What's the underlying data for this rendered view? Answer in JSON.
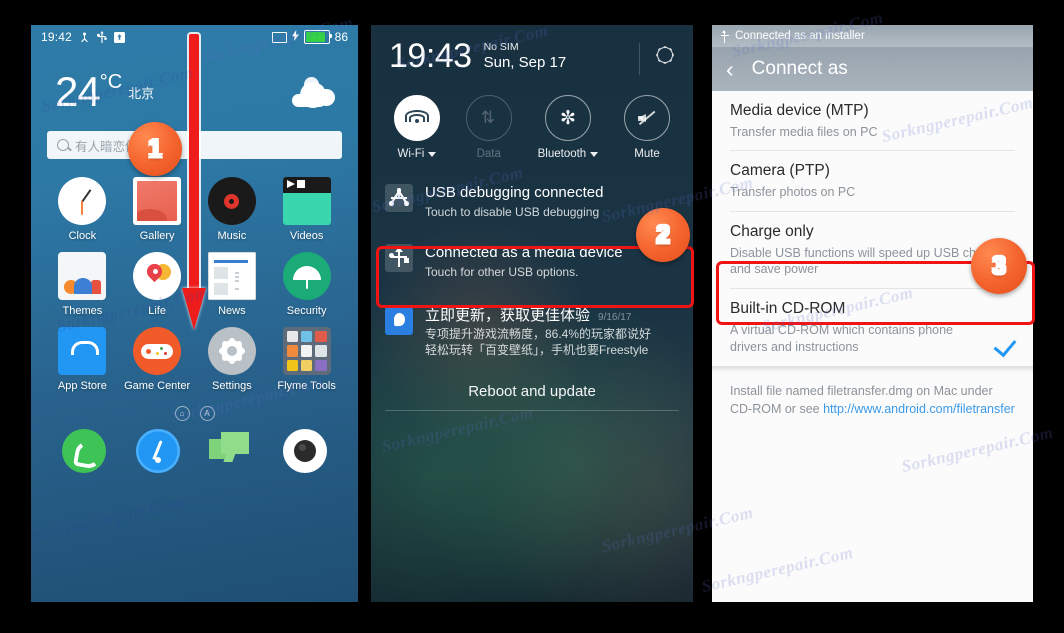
{
  "meta": {
    "watermark_text": "Sorkngperepair.Com"
  },
  "panel1": {
    "name": "Flyme home screen",
    "status_bar": {
      "time": "19:42",
      "battery_percent": "86",
      "icons": [
        "adb-icon",
        "usb-icon",
        "download-icon",
        "sim-icon",
        "charging-icon",
        "battery-icon"
      ]
    },
    "weather": {
      "temperature": "24",
      "degree_symbol": "°C",
      "city": "北京",
      "icon": "partly-cloudy-icon"
    },
    "search": {
      "placeholder": "有人暗恋你",
      "icon": "search-icon"
    },
    "apps": [
      {
        "label": "Clock",
        "icon": "clock-icon"
      },
      {
        "label": "Gallery",
        "icon": "gallery-icon"
      },
      {
        "label": "Music",
        "icon": "music-icon"
      },
      {
        "label": "Videos",
        "icon": "videos-icon"
      },
      {
        "label": "Themes",
        "icon": "themes-icon"
      },
      {
        "label": "Life",
        "icon": "life-icon"
      },
      {
        "label": "News",
        "icon": "news-icon"
      },
      {
        "label": "Security",
        "icon": "security-icon"
      },
      {
        "label": "App Store",
        "icon": "app-store-icon"
      },
      {
        "label": "Game Center",
        "icon": "game-center-icon"
      },
      {
        "label": "Settings",
        "icon": "settings-icon"
      },
      {
        "label": "Flyme Tools",
        "icon": "flyme-tools-icon"
      }
    ],
    "page_indicators": [
      "home-page-dot",
      "apps-page-dot"
    ],
    "dock": [
      {
        "label": "Phone",
        "icon": "phone-icon"
      },
      {
        "label": "Browser",
        "icon": "browser-icon"
      },
      {
        "label": "Messaging",
        "icon": "messaging-icon"
      },
      {
        "label": "Camera",
        "icon": "camera-icon"
      }
    ],
    "gesture": "swipe-down-arrow"
  },
  "panel2": {
    "name": "Notification shade",
    "time": "19:43",
    "sim_status": "No SIM",
    "date": "Sun, Sep 17",
    "settings_icon": "gear-icon",
    "toggles": [
      {
        "label": "Wi-Fi",
        "icon": "wifi-icon",
        "state": "on",
        "has_caret": true
      },
      {
        "label": "Data",
        "icon": "data-icon",
        "state": "disabled",
        "has_caret": false
      },
      {
        "label": "Bluetooth",
        "icon": "bluetooth-icon",
        "state": "off",
        "has_caret": true
      },
      {
        "label": "Mute",
        "icon": "mute-icon",
        "state": "off",
        "has_caret": false
      }
    ],
    "notifications": [
      {
        "title": "USB debugging connected",
        "subtitle": "Touch to disable USB debugging",
        "icon": "adb-icon",
        "date": "",
        "highlighted": false
      },
      {
        "title": "Connected as a media device",
        "subtitle": "Touch for other USB options.",
        "icon": "usb-icon",
        "date": "",
        "highlighted": true
      },
      {
        "title": "立即更新，获取更佳体验",
        "subtitle": "专项提升游戏流畅度，86.4%的玩家都说好\n轻松玩转「百变壁纸」，手机也要Freestyle",
        "icon": "update-icon",
        "date": "9/16/17",
        "highlighted": false
      }
    ],
    "action_label": "Reboot and update"
  },
  "panel3": {
    "name": "Connect as dialog",
    "status_bar": {
      "text": "Connected as an installer",
      "icon": "usb-icon"
    },
    "appbar": {
      "back_icon": "back-chevron-icon",
      "title": "Connect as"
    },
    "options": [
      {
        "title": "Media device (MTP)",
        "subtitle": "Transfer media files on PC",
        "selected": false,
        "highlighted": false
      },
      {
        "title": "Camera (PTP)",
        "subtitle": "Transfer photos on PC",
        "selected": false,
        "highlighted": false
      },
      {
        "title": "Charge only",
        "subtitle": "Disable USB functions will speed up USB charging and save power",
        "selected": false,
        "highlighted": false
      },
      {
        "title": "Built-in CD-ROM",
        "subtitle": "A virtual CD-ROM which contains phone drivers and instructions",
        "selected": true,
        "highlighted": true,
        "check_icon": "checkmark-icon"
      }
    ],
    "footnote": {
      "text_before": "Install file named filetransfer.dmg on Mac under CD-ROM or see ",
      "link": "http://www.android.com/filetransfer"
    }
  },
  "badges": {
    "step1": "1",
    "step2": "2",
    "step3": "3",
    "color": "#f4622d"
  },
  "colors": {
    "accent_red": "#f01414",
    "badge_orange": "#f4622d",
    "link_blue": "#3b9ae8",
    "check_blue": "#2196f3",
    "battery_green": "#35d146"
  }
}
